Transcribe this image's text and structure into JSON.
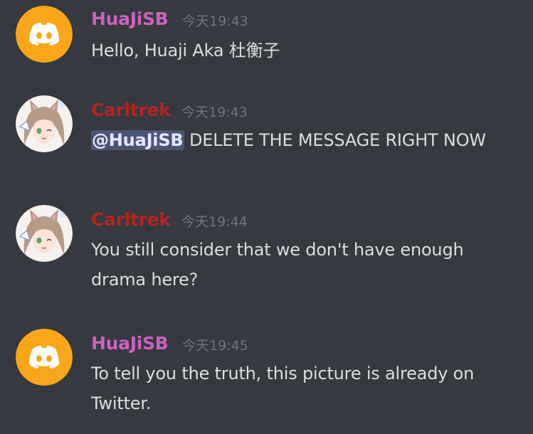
{
  "messages": [
    {
      "author": "HuaJiSB",
      "time": "今天19:43",
      "text": "Hello, Huaji Aka 杜衡子",
      "avatar_icon": "discord-logo-icon"
    },
    {
      "author": "Carltrek",
      "time": "今天19:43",
      "mention": "@HuaJiSB",
      "text": " DELETE THE MESSAGE RIGHT NOW",
      "avatar_icon": "anime-girl-avatar"
    },
    {
      "author": "Carltrek",
      "time": "今天19:44",
      "text": "You still consider that we don't have enough drama here?",
      "avatar_icon": "anime-girl-avatar"
    },
    {
      "author": "HuaJiSB",
      "time": "今天19:45",
      "text": "To tell you the truth, this picture is already on Twitter.",
      "avatar_icon": "discord-logo-icon"
    }
  ],
  "colors": {
    "background": "#36393f",
    "huajisb_name": "#ca62bd",
    "carltrek_name": "#b32522",
    "timestamp": "#72767d",
    "text": "#dcddde",
    "discord_avatar_bg": "#faa61a",
    "mention_bg": "#4a5488"
  }
}
